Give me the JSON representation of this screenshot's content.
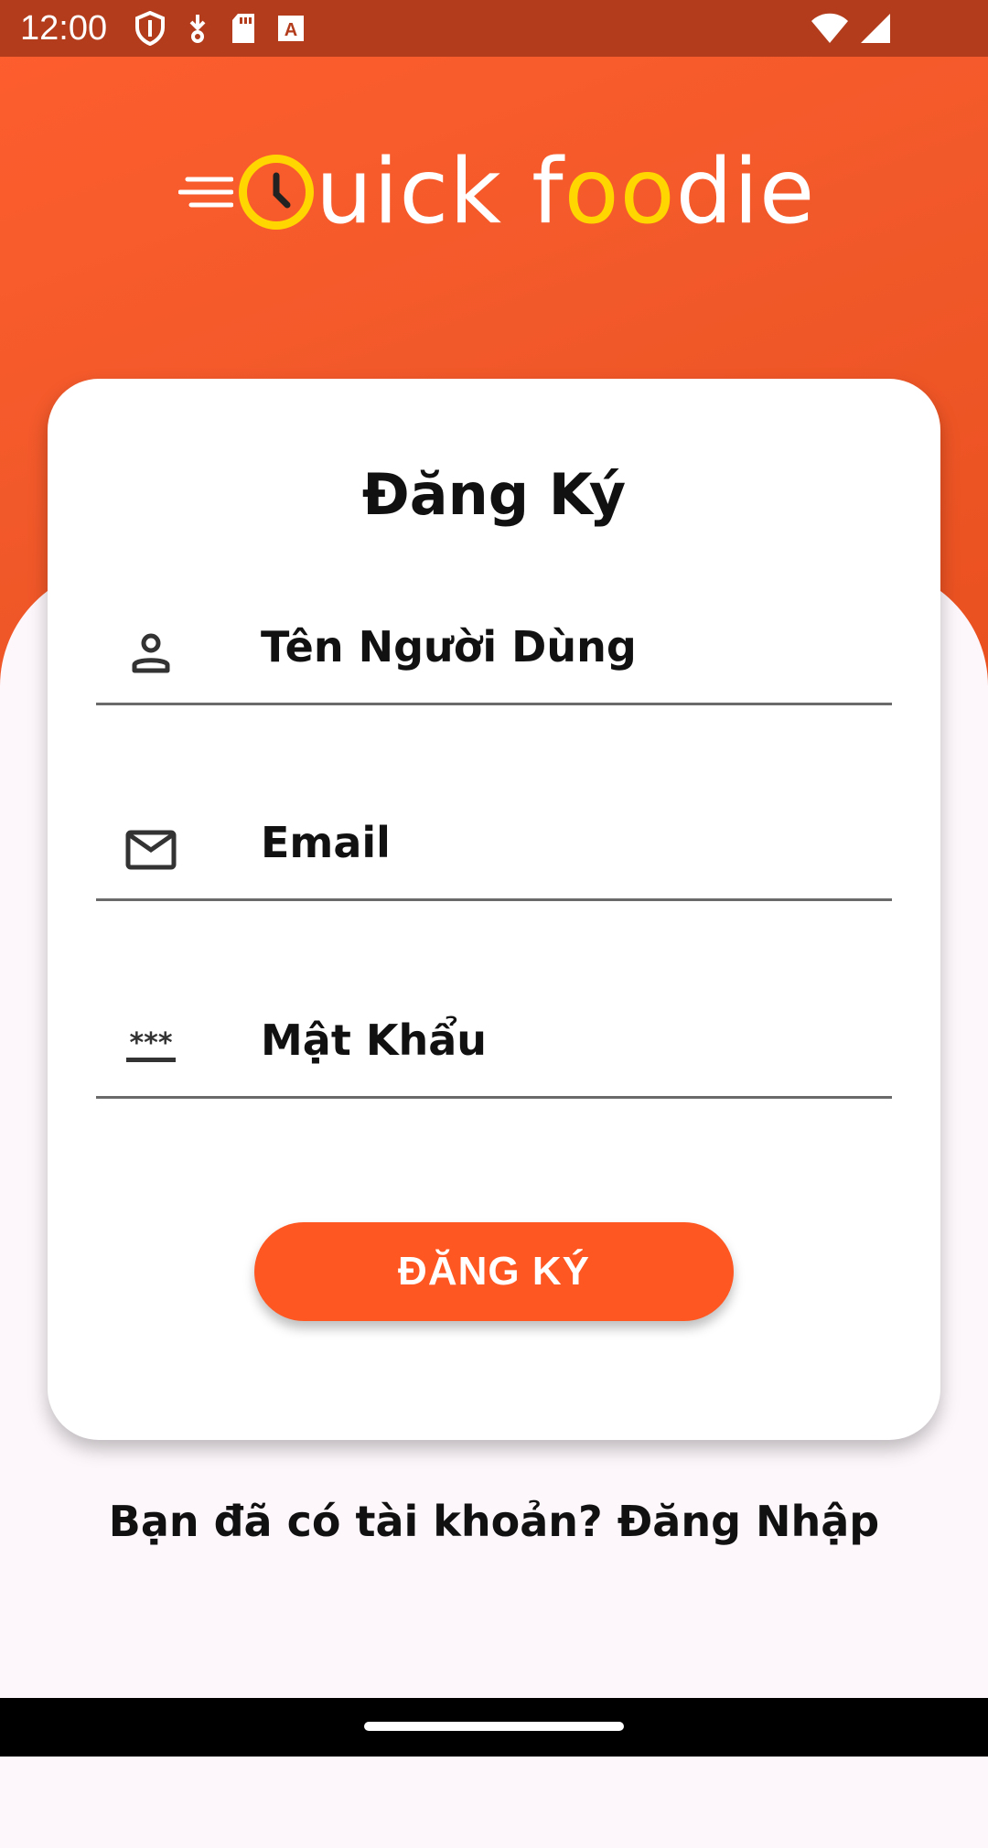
{
  "status_bar": {
    "time": "12:00",
    "icons": [
      "shield-icon",
      "download-icon",
      "sd-card-icon",
      "text-a-icon"
    ],
    "right_icons": [
      "wifi-icon",
      "signal-icon"
    ]
  },
  "logo": {
    "text_prefix": "uick ",
    "text_f": "f",
    "text_oo": "oo",
    "text_suffix": "die",
    "brand_yellow": "#ffd600"
  },
  "form": {
    "title": "Đăng Ký",
    "fields": [
      {
        "icon": "person-icon",
        "label": "Tên Người Dùng"
      },
      {
        "icon": "mail-icon",
        "label": "Email"
      },
      {
        "icon": "password-icon",
        "label": "Mật Khẩu"
      }
    ],
    "submit_label": "ĐĂNG KÝ"
  },
  "footer": {
    "login_prompt": "Bạn đã có tài khoản? Đăng Nhập"
  },
  "colors": {
    "accent": "#ff5722",
    "header_gradient_start": "#ff5e2e",
    "header_gradient_end": "#e64d1c",
    "status_bar": "#b23c1c"
  }
}
